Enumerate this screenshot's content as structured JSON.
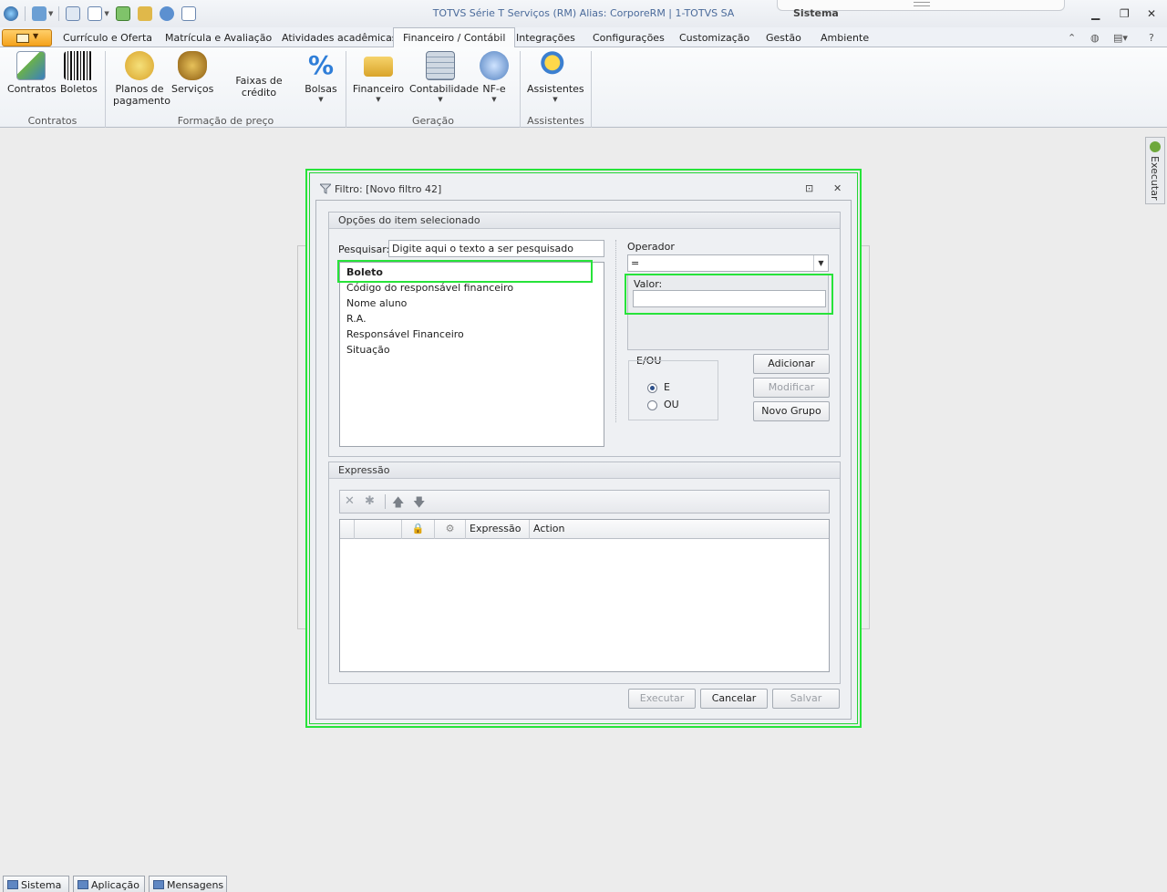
{
  "window": {
    "title": "TOTVS Série T Serviços (RM) Alias: CorporeRM | 1-TOTVS SA",
    "system_tab": "Sistema"
  },
  "ribbon": {
    "tabs": [
      "Currículo e Oferta",
      "Matrícula e Avaliação",
      "Atividades acadêmicas",
      "Financeiro / Contábil",
      "Integrações",
      "Configurações",
      "Customização",
      "Gestão",
      "Ambiente"
    ],
    "active_tab": "Financeiro / Contábil",
    "buttons": {
      "contratos": "Contratos",
      "boletos": "Boletos",
      "planos_l1": "Planos de",
      "planos_l2": "pagamento",
      "servicos": "Serviços",
      "faixas": "Faixas de crédito",
      "bolsas": "Bolsas",
      "financeiro": "Financeiro",
      "contabilidade": "Contabilidade",
      "nfe": "NF-e",
      "assistentes": "Assistentes"
    },
    "groups": {
      "contratos": "Contratos",
      "formacao": "Formação de preço",
      "geracao": "Geração",
      "assistentes": "Assistentes"
    }
  },
  "side_panel": {
    "executar": "Executar"
  },
  "dialog": {
    "title": "Filtro: [Novo filtro 42]",
    "options_group": "Opções do item selecionado",
    "search_label": "Pesquisar:",
    "search_value": "Digite aqui o texto a ser pesquisado",
    "fields": [
      "Boleto",
      "Código do responsável financeiro",
      "Nome aluno",
      "R.A.",
      "Responsável Financeiro",
      "Situação"
    ],
    "operator_label": "Operador",
    "operator_value": "=",
    "value_label": "Valor:",
    "value_value": "",
    "logic_label": "E/OU",
    "logic_options": [
      "E",
      "OU"
    ],
    "logic_selected": "E",
    "btn_add": "Adicionar",
    "btn_modify": "Modificar",
    "btn_new_group": "Novo Grupo",
    "expression_group": "Expressão",
    "grid_columns": [
      "Expressão",
      "Action"
    ],
    "btn_execute": "Executar",
    "btn_cancel": "Cancelar",
    "btn_save": "Salvar"
  },
  "statusbar": {
    "tabs": [
      "Sistema",
      "Aplicação",
      "Mensagens"
    ]
  },
  "icons": {
    "accent": "#27e33a",
    "app_button": "#f4a21c"
  }
}
